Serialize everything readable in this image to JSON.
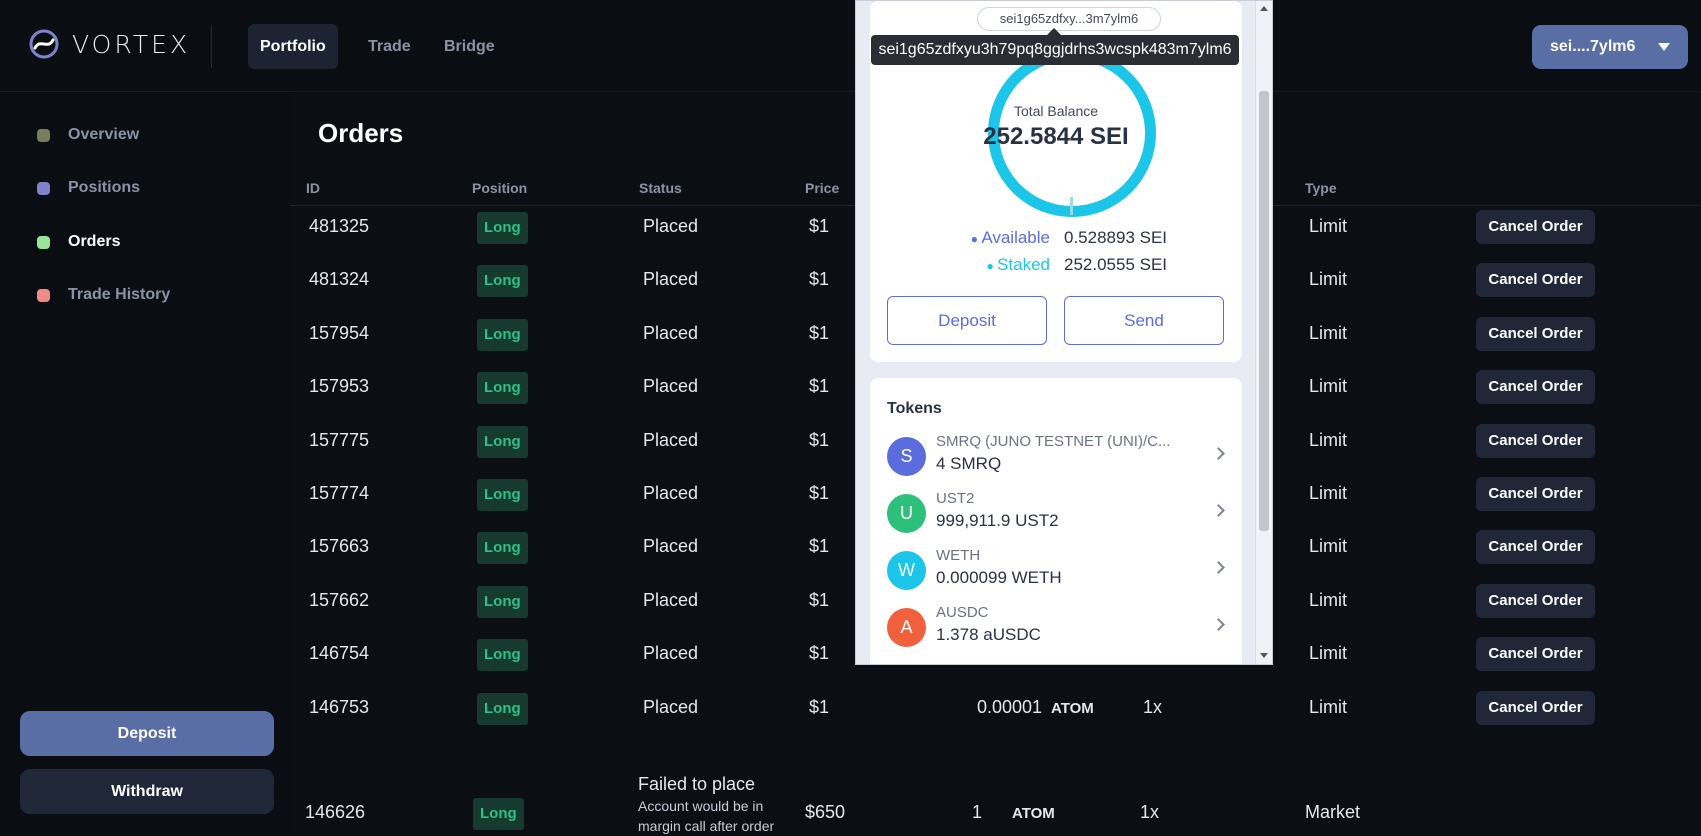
{
  "app": {
    "brand": "VORTEX",
    "nav_tabs": [
      {
        "label": "Portfolio"
      },
      {
        "label": "Trade"
      },
      {
        "label": "Bridge"
      }
    ],
    "wallet_button": "sei....7ylm6"
  },
  "sidebar": {
    "items": [
      {
        "label": "Overview",
        "color": "#7a7d5c"
      },
      {
        "label": "Positions",
        "color": "#7f82c9"
      },
      {
        "label": "Orders",
        "color": "#9be39b"
      },
      {
        "label": "Trade History",
        "color": "#f08a8a"
      }
    ],
    "deposit_label": "Deposit",
    "withdraw_label": "Withdraw"
  },
  "orders": {
    "title": "Orders",
    "columns": [
      "ID",
      "Position",
      "Status",
      "Price",
      "Type"
    ],
    "rows": [
      {
        "id": "481325",
        "position": "Long",
        "status": "Placed",
        "price": "$1",
        "type": "Limit",
        "action": "Cancel Order"
      },
      {
        "id": "481324",
        "position": "Long",
        "status": "Placed",
        "price": "$1",
        "type": "Limit",
        "action": "Cancel Order"
      },
      {
        "id": "157954",
        "position": "Long",
        "status": "Placed",
        "price": "$1",
        "type": "Limit",
        "action": "Cancel Order"
      },
      {
        "id": "157953",
        "position": "Long",
        "status": "Placed",
        "price": "$1",
        "type": "Limit",
        "action": "Cancel Order"
      },
      {
        "id": "157775",
        "position": "Long",
        "status": "Placed",
        "price": "$1",
        "type": "Limit",
        "action": "Cancel Order"
      },
      {
        "id": "157774",
        "position": "Long",
        "status": "Placed",
        "price": "$1",
        "type": "Limit",
        "action": "Cancel Order"
      },
      {
        "id": "157663",
        "position": "Long",
        "status": "Placed",
        "price": "$1",
        "type": "Limit",
        "action": "Cancel Order"
      },
      {
        "id": "157662",
        "position": "Long",
        "status": "Placed",
        "price": "$1",
        "type": "Limit",
        "action": "Cancel Order"
      },
      {
        "id": "146754",
        "position": "Long",
        "status": "Placed",
        "price": "$1",
        "type": "Limit",
        "action": "Cancel Order"
      },
      {
        "id": "146753",
        "position": "Long",
        "status": "Placed",
        "price": "$1",
        "quantity": "0.00001",
        "asset": "ATOM",
        "leverage": "1x",
        "type": "Limit",
        "action": "Cancel Order"
      }
    ],
    "failed_row": {
      "id": "146626",
      "position": "Long",
      "status_title": "Failed to place",
      "status_line1": "Account would be in",
      "status_line2": "margin call after order",
      "price": "$650",
      "quantity": "1",
      "asset": "ATOM",
      "leverage": "1x",
      "type": "Market"
    }
  },
  "wallet_popup": {
    "address_short": "sei1g65zdfxy...3m7ylm6",
    "address_full": "sei1g65zdfxyu3h79pq8ggjdrhs3wcspk483m7ylm6",
    "total_balance_label": "Total Balance",
    "total_balance_value": "252.5844 SEI",
    "available_label": "Available",
    "available_value": "0.528893 SEI",
    "staked_label": "Staked",
    "staked_value": "252.0555 SEI",
    "deposit_label": "Deposit",
    "send_label": "Send",
    "tokens_title": "Tokens",
    "tokens": [
      {
        "letter": "S",
        "name": "SMRQ (JUNO TESTNET (UNI)/C...",
        "amount": "4 SMRQ",
        "color": "#5b6ddc"
      },
      {
        "letter": "U",
        "name": "UST2",
        "amount": "999,911.9 UST2",
        "color": "#2cc07a"
      },
      {
        "letter": "W",
        "name": "WETH",
        "amount": "0.000099 WETH",
        "color": "#1bc6e8"
      },
      {
        "letter": "A",
        "name": "AUSDC",
        "amount": "1.378 aUSDC",
        "color": "#f0603c"
      }
    ],
    "colors": {
      "accent": "#5b6ddc",
      "ring": "#1bc6e8"
    }
  }
}
